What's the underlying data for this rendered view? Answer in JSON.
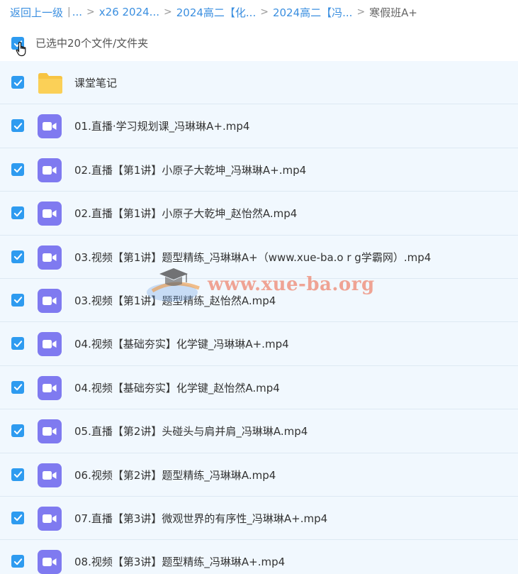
{
  "breadcrumb": {
    "items": [
      "返回上一级",
      "...",
      "x26 2024...",
      "2024高二【化...",
      "2024高二【冯..."
    ],
    "separators": [
      "|",
      ">",
      ">",
      ">",
      ">"
    ],
    "current": "寒假班A+"
  },
  "selection": {
    "text": "已选中20个文件/文件夹",
    "checked": true
  },
  "files": [
    {
      "name": "课堂笔记",
      "type": "folder",
      "checked": true
    },
    {
      "name": "01.直播·学习规划课_冯琳琳A+.mp4",
      "type": "video",
      "checked": true
    },
    {
      "name": "02.直播【第1讲】小原子大乾坤_冯琳琳A+.mp4",
      "type": "video",
      "checked": true
    },
    {
      "name": "02.直播【第1讲】小原子大乾坤_赵怡然A.mp4",
      "type": "video",
      "checked": true
    },
    {
      "name": "03.视频【第1讲】题型精练_冯琳琳A+（www.xue-ba.o r g学霸网）.mp4",
      "type": "video",
      "checked": true
    },
    {
      "name": "03.视频【第1讲】题型精练_赵怡然A.mp4",
      "type": "video",
      "checked": true
    },
    {
      "name": "04.视频【基础夯实】化学键_冯琳琳A+.mp4",
      "type": "video",
      "checked": true
    },
    {
      "name": "04.视频【基础夯实】化学键_赵怡然A.mp4",
      "type": "video",
      "checked": true
    },
    {
      "name": "05.直播【第2讲】头碰头与肩并肩_冯琳琳A.mp4",
      "type": "video",
      "checked": true
    },
    {
      "name": "06.视频【第2讲】题型精练_冯琳琳A.mp4",
      "type": "video",
      "checked": true
    },
    {
      "name": "07.直播【第3讲】微观世界的有序性_冯琳琳A+.mp4",
      "type": "video",
      "checked": true
    },
    {
      "name": "08.视频【第3讲】题型精练_冯琳琳A+.mp4",
      "type": "video",
      "checked": true
    }
  ],
  "watermark": {
    "text": "www.xue-ba.org"
  },
  "colors": {
    "link": "#3b8fe0",
    "checkbox": "#2e9bf0",
    "video_icon": "#7f7af0",
    "folder_icon": "#f7c443",
    "row_bg": "#f1f8fe"
  },
  "icons": {
    "folder": "folder-icon",
    "video": "video-file-icon",
    "checkbox": "checkbox-checked-icon",
    "cursor": "hand-pointer-icon"
  }
}
